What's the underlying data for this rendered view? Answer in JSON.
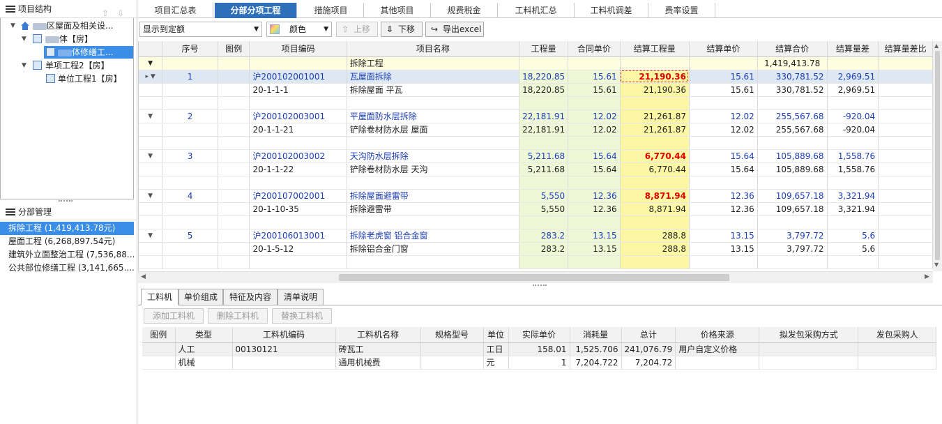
{
  "left_panel": {
    "title": "项目结构",
    "tree": [
      {
        "label_a": "",
        "label_b": "区屋面及相关设..."
      },
      {
        "label_a": "",
        "label_b": "体【房】"
      },
      {
        "label_a": "",
        "label_b": "体修缮工..."
      },
      {
        "label_a": "单项工程2【房】",
        "label_b": ""
      },
      {
        "label_a": "单位工程1【房】",
        "label_b": ""
      }
    ],
    "manager_title": "分部管理",
    "manager_items": [
      "拆除工程 (1,419,413.78元)",
      "屋面工程 (6,268,897.54元)",
      "建筑外立面整治工程 (7,536,88...",
      "公共部位修缮工程 (3,141,665...."
    ]
  },
  "tabs": [
    "项目汇总表",
    "分部分项工程",
    "措施项目",
    "其他项目",
    "规费税金",
    "工料机汇总",
    "工料机调差",
    "费率设置"
  ],
  "toolbar": {
    "display_select": "显示到定额",
    "color_select": "颜色",
    "up_label": "上移",
    "down_label": "下移",
    "export_label": "导出excel"
  },
  "grid": {
    "headers": [
      "",
      "序号",
      "图例",
      "项目编码",
      "项目名称",
      "工程量",
      "合同单价",
      "结算工程量",
      "结算单价",
      "结算合价",
      "结算量差",
      "结算量差比"
    ],
    "group_row": {
      "name": "拆除工程",
      "total": "1,419,413.78"
    },
    "items": [
      {
        "no": "1",
        "code": "沪200102001001",
        "name": "瓦屋面拆除",
        "qty": "18,220.85",
        "price": "15.61",
        "sqty": "21,190.36",
        "sprice": "15.61",
        "stotal": "330,781.52",
        "diff": "2,969.51",
        "sub_code": "20-1-1-1",
        "sub_name": "拆除屋面 平瓦",
        "sub_qty": "18,220.85",
        "sub_price": "15.61",
        "sub_sqty": "21,190.36",
        "sub_sprice": "15.61",
        "sub_stotal": "330,781.52",
        "sub_diff": "2,969.51"
      },
      {
        "no": "2",
        "code": "沪200102003001",
        "name": "平屋面防水层拆除",
        "qty": "22,181.91",
        "price": "12.02",
        "sqty": "21,261.87",
        "sprice": "12.02",
        "stotal": "255,567.68",
        "diff": "-920.04",
        "sub_code": "20-1-1-21",
        "sub_name": "铲除卷材防水层 屋面",
        "sub_qty": "22,181.91",
        "sub_price": "12.02",
        "sub_sqty": "21,261.87",
        "sub_sprice": "12.02",
        "sub_stotal": "255,567.68",
        "sub_diff": "-920.04"
      },
      {
        "no": "3",
        "code": "沪200102003002",
        "name": "天沟防水层拆除",
        "qty": "5,211.68",
        "price": "15.64",
        "sqty": "6,770.44",
        "sprice": "15.64",
        "stotal": "105,889.68",
        "diff": "1,558.76",
        "sub_code": "20-1-1-22",
        "sub_name": "铲除卷材防水层 天沟",
        "sub_qty": "5,211.68",
        "sub_price": "15.64",
        "sub_sqty": "6,770.44",
        "sub_sprice": "15.64",
        "sub_stotal": "105,889.68",
        "sub_diff": "1,558.76"
      },
      {
        "no": "4",
        "code": "沪200107002001",
        "name": "拆除屋面避雷带",
        "qty": "5,550",
        "price": "12.36",
        "sqty": "8,871.94",
        "sprice": "12.36",
        "stotal": "109,657.18",
        "diff": "3,321.94",
        "sub_code": "20-1-10-35",
        "sub_name": "拆除避雷带",
        "sub_qty": "5,550",
        "sub_price": "12.36",
        "sub_sqty": "8,871.94",
        "sub_sprice": "12.36",
        "sub_stotal": "109,657.18",
        "sub_diff": "3,321.94"
      },
      {
        "no": "5",
        "code": "沪200106013001",
        "name": "拆除老虎窗 铝合金窗",
        "qty": "283.2",
        "price": "13.15",
        "sqty": "288.8",
        "sprice": "13.15",
        "stotal": "3,797.72",
        "diff": "5.6",
        "sub_code": "20-1-5-12",
        "sub_name": "拆除铝合金门窗",
        "sub_qty": "283.2",
        "sub_price": "13.15",
        "sub_sqty": "288.8",
        "sub_sprice": "13.15",
        "sub_stotal": "3,797.72",
        "sub_diff": "5.6"
      }
    ]
  },
  "bottom_tabs": [
    "工料机",
    "单价组成",
    "特征及内容",
    "清单说明"
  ],
  "bottom_toolbar": [
    "添加工料机",
    "删除工料机",
    "替换工料机"
  ],
  "labor_grid": {
    "headers": [
      "图例",
      "类型",
      "工料机编码",
      "工料机名称",
      "规格型号",
      "单位",
      "实际单价",
      "消耗量",
      "总计",
      "价格来源",
      "拟发包采购方式",
      "发包采购人"
    ],
    "rows": [
      [
        "",
        "人工",
        "00130121",
        "砖瓦工",
        "",
        "工日",
        "158.01",
        "1,525.706",
        "241,076.79",
        "用户自定义价格",
        "",
        ""
      ],
      [
        "",
        "机械",
        "",
        "通用机械费",
        "",
        "元",
        "1",
        "7,204.722",
        "7,204.72",
        "",
        "",
        ""
      ]
    ]
  }
}
